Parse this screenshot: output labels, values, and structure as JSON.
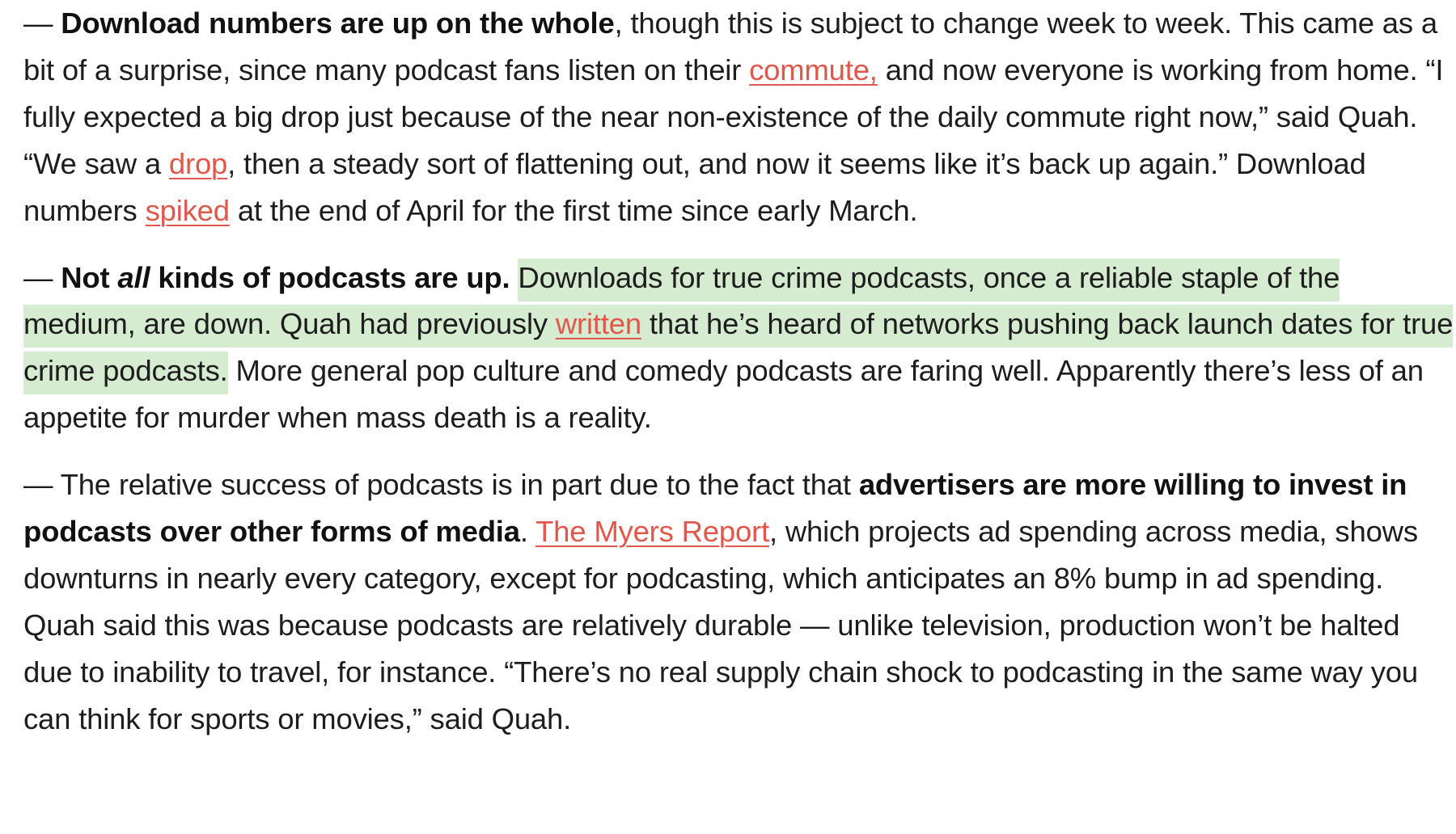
{
  "paragraphs": {
    "p1": {
      "dash": "— ",
      "bold": "Download numbers are up on the whole",
      "t1": ", though this is subject to change week to week. This came as a bit of a surprise, since many podcast fans listen on their ",
      "link1": "commute,",
      "t2": " and now everyone is working from home. “I fully expected a big drop just because of the near non-existence of the daily commute right now,” said Quah. “We saw a ",
      "link2": "drop",
      "t3": ", then a steady sort of flattening out, and now it seems like it’s back up again.” Download numbers ",
      "link3": "spiked",
      "t4": " at the end of April for the first time since early March."
    },
    "p2": {
      "dash": "— ",
      "bold_a": "Not ",
      "bold_italic": "all",
      "bold_b": " kinds of podcasts are up.",
      "space": " ",
      "hl1": "Downloads for true crime podcasts, once a reliable staple of the medium, are down. Quah had previously ",
      "link1": "written",
      "hl2": " that he’s heard of networks pushing back launch dates for true crime podcasts.",
      "t1": " More general pop culture and comedy podcasts are faring well. Apparently there’s less of an appetite for murder when mass death is a reality."
    },
    "p3": {
      "dash": "— ",
      "t1": "The relative success of podcasts is in part due to the fact that ",
      "bold": "advertisers are more willing to invest in podcasts over other forms of media",
      "t2": ". ",
      "link1": "The Myers Report",
      "t3": ", which projects ad spending across media, shows downturns in nearly every category, except for podcasting, which anticipates an 8% bump in ad spending. Quah said this was because podcasts are relatively durable — unlike television, production won’t be halted due to inability to travel, for instance. “There’s no real supply chain shock to podcasting in the same way you can think for sports or movies,” said Quah."
    }
  },
  "colors": {
    "text": "#1d1d1d",
    "link": "#e0574b",
    "highlight": "#d5ecd0"
  }
}
